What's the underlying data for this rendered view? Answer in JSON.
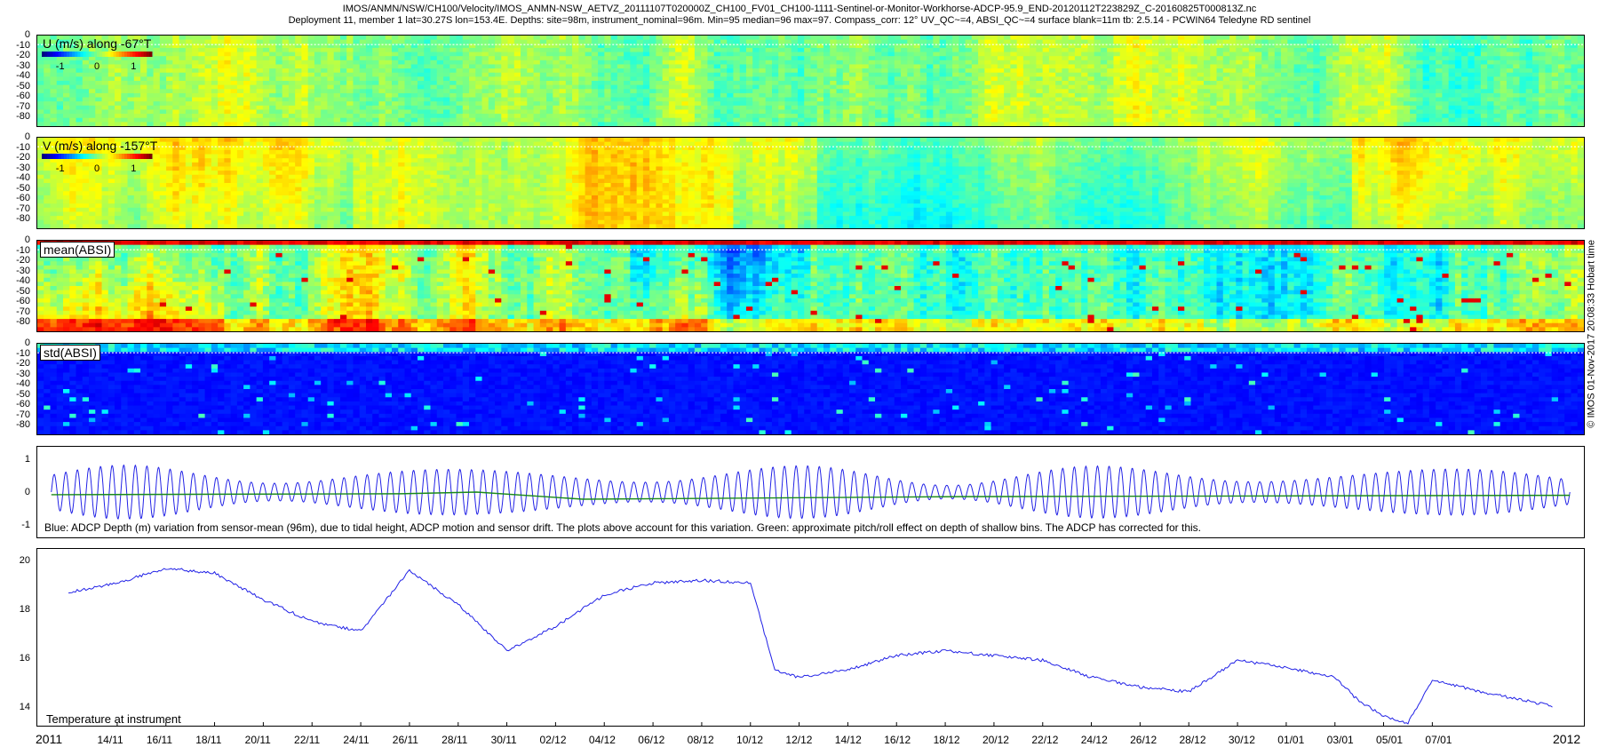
{
  "header": {
    "line1": "IMOS/ANMN/NSW/CH100/Velocity/IMOS_ANMN-NSW_AETVZ_20111107T020000Z_CH100_FV01_CH100-1111-Sentinel-or-Monitor-Workhorse-ADCP-95.9_END-20120112T223829Z_C-20160825T000813Z.nc",
    "line2": "Deployment 11, member 1 lat=30.27S lon=153.4E. Depths: site=98m, instrument_nominal=96m. Min=95 median=96 max=97. Compass_corr: 12° UV_QC~=4, ABSI_QC~=4 surface blank=11m tb: 2.5.14 - PCWIN64 Teledyne RD sentinel"
  },
  "side_note": "© IMOS 01-Nov-2017 20:08:33 Hobart time",
  "colors": {
    "tide": "#1f1fe6",
    "pitch": "#1a8a1a",
    "temperature": "#1f1fe6"
  },
  "chart_data": [
    {
      "type": "heatmap",
      "title": "U (m/s) along -67°T",
      "colorbar_ticks": [
        "-1",
        "0",
        "1"
      ],
      "clim": [
        -1.5,
        1.5
      ],
      "y_ticks": [
        "0",
        "-10",
        "-20",
        "-30",
        "-40",
        "-50",
        "-60",
        "-70",
        "-80"
      ],
      "ylim": [
        -90,
        0
      ],
      "colormap": "jet",
      "dominant_value": 0
    },
    {
      "type": "heatmap",
      "title": "V (m/s) along -157°T",
      "colorbar_ticks": [
        "-1",
        "0",
        "1"
      ],
      "clim": [
        -1.5,
        1.5
      ],
      "y_ticks": [
        "0",
        "-10",
        "-20",
        "-30",
        "-40",
        "-50",
        "-60",
        "-70",
        "-80"
      ],
      "ylim": [
        -90,
        0
      ],
      "colormap": "jet",
      "dominant_value": 0.5
    },
    {
      "type": "heatmap",
      "title": "mean(ABSI)",
      "y_ticks": [
        "0",
        "-10",
        "-20",
        "-30",
        "-40",
        "-50",
        "-60",
        "-70",
        "-80"
      ],
      "ylim": [
        -90,
        0
      ],
      "colormap": "jet"
    },
    {
      "type": "heatmap",
      "title": "std(ABSI)",
      "y_ticks": [
        "0",
        "-10",
        "-20",
        "-30",
        "-40",
        "-50",
        "-60",
        "-70",
        "-80"
      ],
      "ylim": [
        -90,
        0
      ],
      "colormap": "jet"
    },
    {
      "type": "line",
      "caption": "Blue: ADCP Depth (m) variation from sensor-mean (96m), due to tidal height, ADCP motion and sensor drift. The plots above account for this variation. Green: approximate pitch/roll effect on depth of shallow bins. The ADCP has corrected for this.",
      "y_ticks": [
        "1",
        "0",
        "-1"
      ],
      "ylim": [
        -1.4,
        1.4
      ],
      "tide_amplitude": 0.7,
      "tide_cycles": 131,
      "series": [
        {
          "x": [
            0,
            0.23,
            0.28,
            0.35,
            0.6,
            1.0
          ],
          "y": [
            -0.08,
            -0.05,
            0.0,
            -0.22,
            -0.14,
            -0.1
          ]
        }
      ]
    },
    {
      "type": "line",
      "title": "Temperature at instrument",
      "y_ticks": [
        "20",
        "18",
        "16",
        "14"
      ],
      "ylim": [
        13.2,
        20.5
      ],
      "x_dates": [
        "2011-11-12",
        "2011-11-14",
        "2011-11-16",
        "2011-11-18",
        "2011-11-20",
        "2011-11-22",
        "2011-11-24",
        "2011-11-26",
        "2011-11-28",
        "2011-11-30",
        "2011-12-02",
        "2011-12-04",
        "2011-12-06",
        "2011-12-08",
        "2011-12-10",
        "2011-12-11",
        "2011-12-12",
        "2011-12-14",
        "2011-12-16",
        "2011-12-18",
        "2011-12-20",
        "2011-12-22",
        "2011-12-24",
        "2011-12-26",
        "2011-12-28",
        "2011-12-30",
        "2012-01-01",
        "2012-01-03",
        "2012-01-04",
        "2012-01-05",
        "2012-01-06",
        "2012-01-07",
        "2012-01-09",
        "2012-01-12"
      ],
      "y": [
        18.7,
        19.1,
        19.7,
        19.5,
        18.4,
        17.5,
        17.1,
        19.6,
        18.2,
        16.3,
        17.3,
        18.6,
        19.1,
        19.2,
        19.1,
        15.5,
        15.2,
        15.5,
        16.1,
        16.3,
        16.1,
        15.9,
        15.2,
        14.8,
        14.6,
        15.9,
        15.6,
        15.2,
        14.2,
        13.6,
        13.3,
        15.1,
        14.6,
        14.0
      ]
    }
  ],
  "x_axis": {
    "year_left": "2011",
    "year_right": "2012",
    "ticks": [
      "14/11",
      "16/11",
      "18/11",
      "20/11",
      "22/11",
      "24/11",
      "26/11",
      "28/11",
      "30/11",
      "02/12",
      "04/12",
      "06/12",
      "08/12",
      "10/12",
      "12/12",
      "14/12",
      "16/12",
      "18/12",
      "20/12",
      "22/12",
      "24/12",
      "26/12",
      "28/12",
      "30/12",
      "01/01",
      "03/01",
      "05/01",
      "07/01"
    ]
  }
}
